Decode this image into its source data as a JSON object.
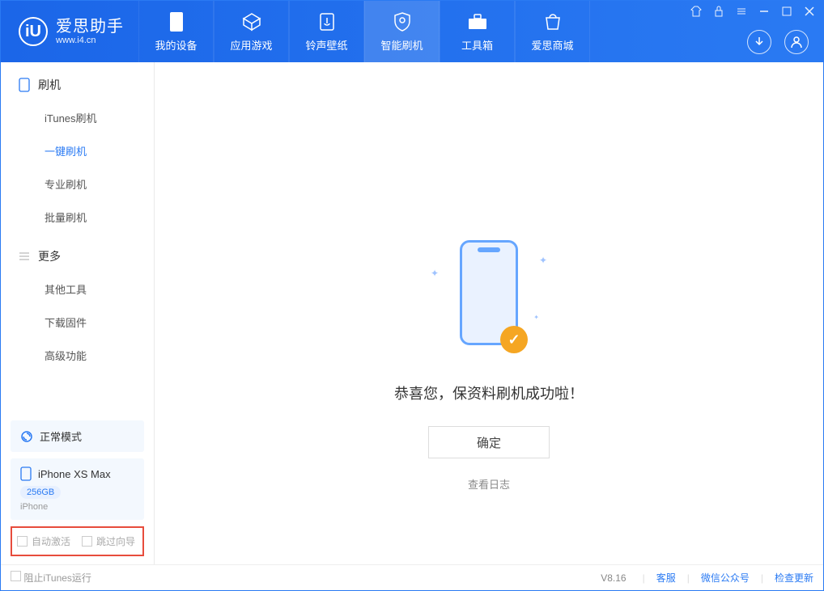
{
  "app": {
    "name_cn": "爱思助手",
    "name_en": "www.i4.cn"
  },
  "colors": {
    "accent": "#2a7af3",
    "accent_dark": "#1b66e8",
    "danger": "#e74c3c",
    "badge": "#f5a623"
  },
  "tabs": [
    {
      "label": "我的设备",
      "icon": "device-icon"
    },
    {
      "label": "应用游戏",
      "icon": "apps-icon"
    },
    {
      "label": "铃声壁纸",
      "icon": "ringtone-icon"
    },
    {
      "label": "智能刷机",
      "icon": "shield-icon",
      "active": true
    },
    {
      "label": "工具箱",
      "icon": "toolbox-icon"
    },
    {
      "label": "爱思商城",
      "icon": "shop-icon"
    }
  ],
  "sidebar": {
    "section1": {
      "title": "刷机",
      "items": [
        "iTunes刷机",
        "一键刷机",
        "专业刷机",
        "批量刷机"
      ],
      "active_index": 1
    },
    "section2": {
      "title": "更多",
      "items": [
        "其他工具",
        "下载固件",
        "高级功能"
      ]
    },
    "mode": "正常模式",
    "device": {
      "name": "iPhone XS Max",
      "storage": "256GB",
      "type": "iPhone"
    },
    "checkboxes": {
      "auto_activate": "自动激活",
      "skip_guide": "跳过向导"
    }
  },
  "main": {
    "message": "恭喜您，保资料刷机成功啦！",
    "ok_button": "确定",
    "log_link": "查看日志"
  },
  "footer": {
    "block_itunes": "阻止iTunes运行",
    "version": "V8.16",
    "links": [
      "客服",
      "微信公众号",
      "检查更新"
    ]
  }
}
